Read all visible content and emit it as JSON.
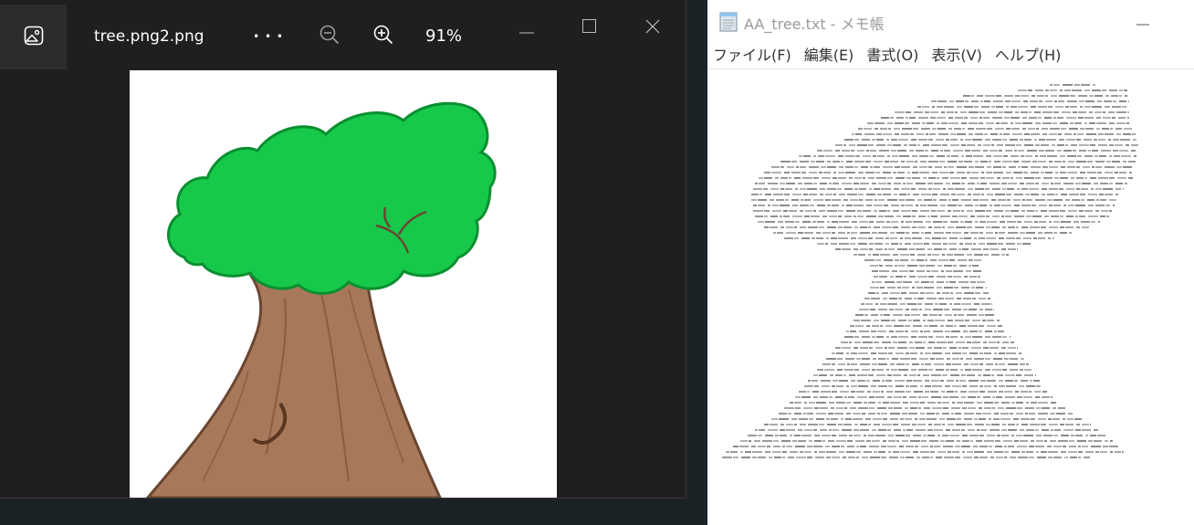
{
  "viewer": {
    "filename": "tree.png2.png",
    "more_label": "• • •",
    "zoom_level": "91%",
    "icons": {
      "app": "image-icon",
      "more": "more-icon",
      "zoom_out": "zoom-out-icon",
      "zoom_in": "zoom-in-icon",
      "minimize": "minimize-icon",
      "maximize": "maximize-icon",
      "close": "close-icon"
    },
    "colors": {
      "background": "#1f1f1f",
      "foliage": "#16c94a",
      "trunk": "#a7795a"
    }
  },
  "notepad": {
    "title": "AA_tree.txt - メモ帳",
    "menu": [
      "ファイル(F)",
      "編集(E)",
      "書式(O)",
      "表示(V)",
      "ヘルプ(H)"
    ],
    "icons": {
      "app": "notepad-icon",
      "minimize": "minimize-icon"
    }
  }
}
